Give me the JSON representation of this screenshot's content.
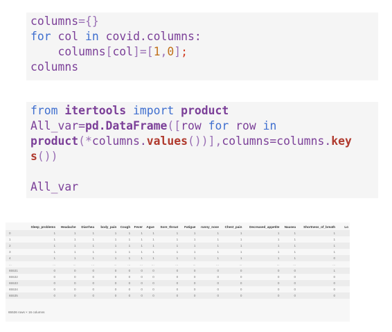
{
  "cell1": {
    "lines": [
      "columns={}",
      "for col in covid.columns:",
      "    columns[col]=[1,0];",
      "columns"
    ]
  },
  "cell2": {
    "lines": [
      "from itertools import product",
      "All_var=pd.DataFrame([row for row in",
      "product(*columns.values())],columns=columns.key",
      "s())",
      "",
      "All_var"
    ]
  },
  "output": {
    "columns": [
      "",
      "Sleep_problems",
      "Headache",
      "Diarrhea",
      "body_pain",
      "Cough",
      "Fever",
      "Ague",
      "Sore_throat",
      "Fatigue",
      "runny_nose",
      "Chest_pain",
      "Decreased_appetite",
      "Nausea",
      "Shortness_of_breath",
      "Lo"
    ],
    "rows": [
      [
        "0",
        "1",
        "1",
        "1",
        "1",
        "1",
        "1",
        "1",
        "1",
        "1",
        "1",
        "1",
        "1",
        "1",
        "1",
        ""
      ],
      [
        "1",
        "1",
        "1",
        "1",
        "1",
        "1",
        "1",
        "1",
        "1",
        "1",
        "1",
        "1",
        "1",
        "1",
        "1",
        ""
      ],
      [
        "2",
        "1",
        "1",
        "1",
        "1",
        "1",
        "1",
        "1",
        "1",
        "1",
        "1",
        "1",
        "1",
        "1",
        "1",
        ""
      ],
      [
        "3",
        "1",
        "1",
        "1",
        "1",
        "1",
        "1",
        "1",
        "1",
        "1",
        "1",
        "1",
        "1",
        "1",
        "1",
        ""
      ],
      [
        "4",
        "1",
        "1",
        "1",
        "1",
        "1",
        "1",
        "1",
        "1",
        "1",
        "1",
        "1",
        "1",
        "1",
        "0",
        ""
      ],
      [
        "...",
        "...",
        "...",
        "...",
        "...",
        "...",
        "...",
        "...",
        "...",
        "...",
        "...",
        "...",
        "...",
        "...",
        "...",
        ""
      ],
      [
        "65531",
        "0",
        "0",
        "0",
        "0",
        "0",
        "0",
        "0",
        "0",
        "0",
        "0",
        "0",
        "0",
        "0",
        "1",
        ""
      ],
      [
        "65532",
        "0",
        "0",
        "0",
        "0",
        "0",
        "0",
        "0",
        "0",
        "0",
        "0",
        "0",
        "0",
        "0",
        "0",
        ""
      ],
      [
        "65533",
        "0",
        "0",
        "0",
        "0",
        "0",
        "0",
        "0",
        "0",
        "0",
        "0",
        "0",
        "0",
        "0",
        "0",
        ""
      ],
      [
        "65534",
        "0",
        "0",
        "0",
        "0",
        "0",
        "0",
        "0",
        "0",
        "0",
        "0",
        "0",
        "0",
        "0",
        "0",
        ""
      ],
      [
        "65535",
        "0",
        "0",
        "0",
        "0",
        "0",
        "0",
        "0",
        "0",
        "0",
        "0",
        "0",
        "0",
        "0",
        "0",
        ""
      ]
    ],
    "footer": "65536 rows × 16 columns"
  }
}
